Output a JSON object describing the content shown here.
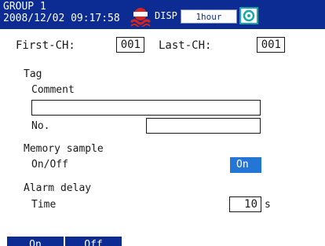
{
  "header": {
    "group_title": "GROUP 1",
    "datetime": "2008/12/02 09:17:58",
    "disp_label": "DISP",
    "rate_label": "1hour",
    "stop_icon": "stop-record-icon",
    "record_icon": "record-status-icon"
  },
  "channels": {
    "first_label": "First-CH:",
    "first_value": "001",
    "last_label": "Last-CH:",
    "last_value": "001"
  },
  "tag": {
    "section_label": "Tag",
    "comment_label": "Comment",
    "comment_value": "",
    "no_label": "No.",
    "no_value": ""
  },
  "memory_sample": {
    "section_label": "Memory sample",
    "onoff_label": "On/Off",
    "onoff_value": "On"
  },
  "alarm_delay": {
    "section_label": "Alarm delay",
    "time_label": "Time",
    "time_value": "10",
    "time_unit": "s"
  },
  "softkeys": [
    {
      "label": "On"
    },
    {
      "label": "Off"
    }
  ],
  "colors": {
    "header_bg": "#0c2c93",
    "selected_bg": "#2476d6",
    "stop_icon": "#d8241c",
    "record_icon": "#16a9a6"
  }
}
